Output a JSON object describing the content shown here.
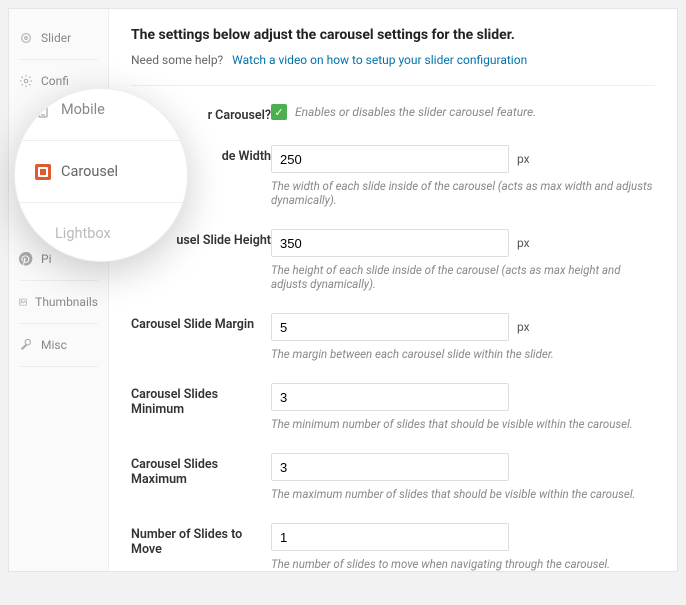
{
  "sidebar": {
    "items": [
      {
        "label": "Slider"
      },
      {
        "label": "Confi"
      },
      {
        "label": "Pi"
      },
      {
        "label": "Thumbnails"
      },
      {
        "label": "Misc"
      }
    ]
  },
  "magnifier": {
    "mobile": "Mobile",
    "carousel": "Carousel",
    "lightbox": "Lightbox"
  },
  "header": {
    "title": "The settings below adjust the carousel settings for the slider.",
    "help_prefix": "Need some help?",
    "help_link": "Watch a video on how to setup your slider configuration"
  },
  "fields": {
    "enable": {
      "label": "r Carousel?",
      "desc": "Enables or disables the slider carousel feature."
    },
    "width": {
      "label": "de Width",
      "value": "250",
      "unit": "px",
      "desc": "The width of each slide inside of the carousel (acts as max width and adjusts dynamically)."
    },
    "height": {
      "label": "usel Slide Height",
      "value": "350",
      "unit": "px",
      "desc": "The height of each slide inside of the carousel (acts as max height and adjusts dynamically)."
    },
    "margin": {
      "label": "Carousel Slide Margin",
      "value": "5",
      "unit": "px",
      "desc": "The margin between each carousel slide within the slider."
    },
    "min": {
      "label": "Carousel Slides Minimum",
      "value": "3",
      "desc": "The minimum number of slides that should be visible within the carousel."
    },
    "max": {
      "label": "Carousel Slides Maximum",
      "value": "3",
      "desc": "The maximum number of slides that should be visible within the carousel."
    },
    "move": {
      "label": "Number of Slides to Move",
      "value": "1",
      "desc": "The number of slides to move when navigating through the carousel."
    }
  }
}
